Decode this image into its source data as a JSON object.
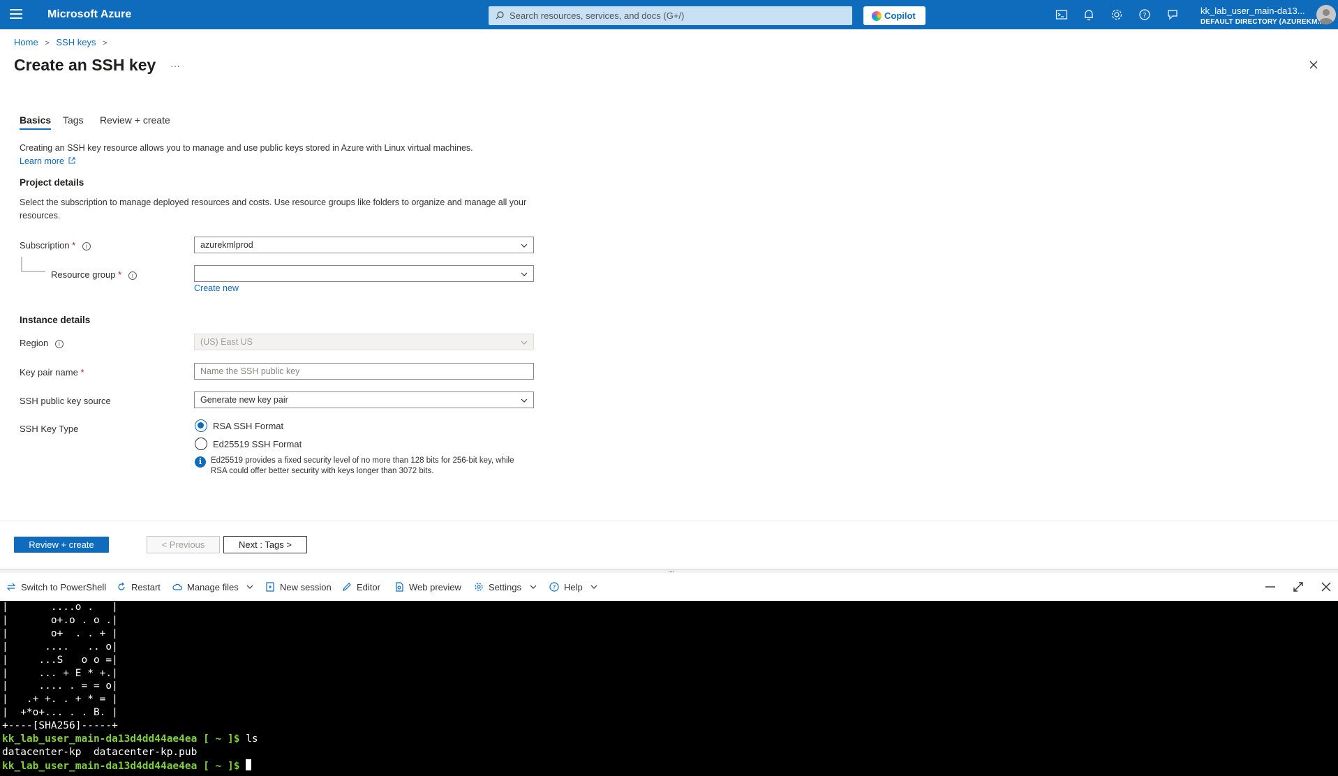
{
  "topbar": {
    "brand": "Microsoft Azure",
    "search_placeholder": "Search resources, services, and docs (G+/)",
    "copilot": "Copilot",
    "user_name": "kk_lab_user_main-da13...",
    "user_directory": "DEFAULT DIRECTORY (AZUREKM..."
  },
  "breadcrumb": {
    "home": "Home",
    "ssh_keys": "SSH keys"
  },
  "page": {
    "title": "Create an SSH key",
    "more": "···"
  },
  "tabs": [
    "Basics",
    "Tags",
    "Review + create"
  ],
  "intro": {
    "text": "Creating an SSH key resource allows you to manage and use public keys stored in Azure with Linux virtual machines.",
    "learn_more": "Learn more"
  },
  "project": {
    "heading": "Project details",
    "desc": "Select the subscription to manage deployed resources and costs. Use resource groups like folders to organize and manage all your resources.",
    "subscription_label": "Subscription",
    "subscription_value": "azurekmlprod",
    "resource_group_label": "Resource group",
    "resource_group_value": "",
    "create_new": "Create new"
  },
  "instance": {
    "heading": "Instance details",
    "region_label": "Region",
    "region_value": "(US) East US",
    "key_pair_label": "Key pair name",
    "key_pair_placeholder": "Name the SSH public key",
    "source_label": "SSH public key source",
    "source_value": "Generate new key pair",
    "key_type_label": "SSH Key Type",
    "key_types": [
      "RSA SSH Format",
      "Ed25519 SSH Format"
    ],
    "key_type_selected": "RSA SSH Format",
    "note": "Ed25519 provides a fixed security level of no more than 128 bits for 256-bit key, while RSA could offer better security with keys longer than 3072 bits."
  },
  "buttons": {
    "review_create": "Review + create",
    "previous": "< Previous",
    "next": "Next : Tags >"
  },
  "shell": {
    "toolbar": [
      "Switch to PowerShell",
      "Restart",
      "Manage files",
      "New session",
      "Editor",
      "Web preview",
      "Settings",
      "Help"
    ],
    "art_lines": [
      "|       ....o .   |",
      "|       o+.o . o .|",
      "|       o+  . . + |",
      "|      ....   .. o|",
      "|     ...S   o o =|",
      "|     ... + E * +.|",
      "|     .... . = = o|",
      "|   .+ +. . + * = |",
      "|  +*o+... . . B. |",
      "+----[SHA256]-----+"
    ],
    "prompt": "kk_lab_user_main-da13d4dd44ae4ea [ ~ ]$",
    "command": " ls",
    "output": "datacenter-kp  datacenter-kp.pub",
    "prompt2": "kk_lab_user_main-da13d4dd44ae4ea [ ~ ]$"
  },
  "colors": {
    "azure_blue": "#0f6cbd",
    "prompt_green": "#7fd13b",
    "required": "#a4262c"
  }
}
